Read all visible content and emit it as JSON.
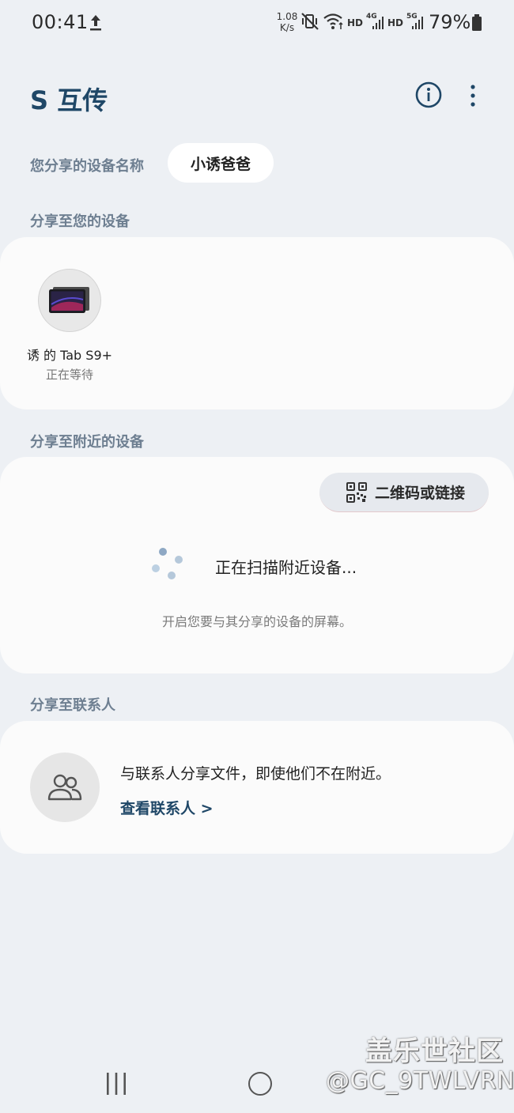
{
  "status_bar": {
    "time": "00:41",
    "speed_value": "1.08",
    "speed_unit": "K/s",
    "hd1": "HD",
    "hd2": "HD",
    "net1": "4G",
    "net2": "5G",
    "battery_percent": "79%",
    "icons": [
      "upload-icon",
      "mute-vibrate-icon",
      "wifi-icon",
      "signal-icon",
      "signal-icon",
      "battery-icon"
    ]
  },
  "header": {
    "title": "S 互传",
    "icons": [
      "info-icon",
      "more-vert-icon"
    ]
  },
  "device_name": {
    "label": "您分享的设备名称",
    "value": "小诱爸爸"
  },
  "your_devices": {
    "title": "分享至您的设备",
    "items": [
      {
        "name": "诱 的 Tab S9+",
        "status": "正在等待",
        "icon": "tablet-icon"
      }
    ]
  },
  "nearby": {
    "title": "分享至附近的设备",
    "qr_button": "二维码或链接",
    "scanning_text": "正在扫描附近设备...",
    "hint": "开启您要与其分享的设备的屏幕。"
  },
  "contacts": {
    "title": "分享至联系人",
    "description": "与联系人分享文件，即使他们不在附近。",
    "link": "查看联系人 >",
    "icon": "contacts-icon"
  },
  "watermark": {
    "main": "盖乐世社区",
    "sub": "@GC_9TWLVRN"
  },
  "colors": {
    "background": "#edf0f4",
    "card": "#fbfbfb",
    "accent": "#1f4767",
    "section_title": "#6e7f91"
  }
}
